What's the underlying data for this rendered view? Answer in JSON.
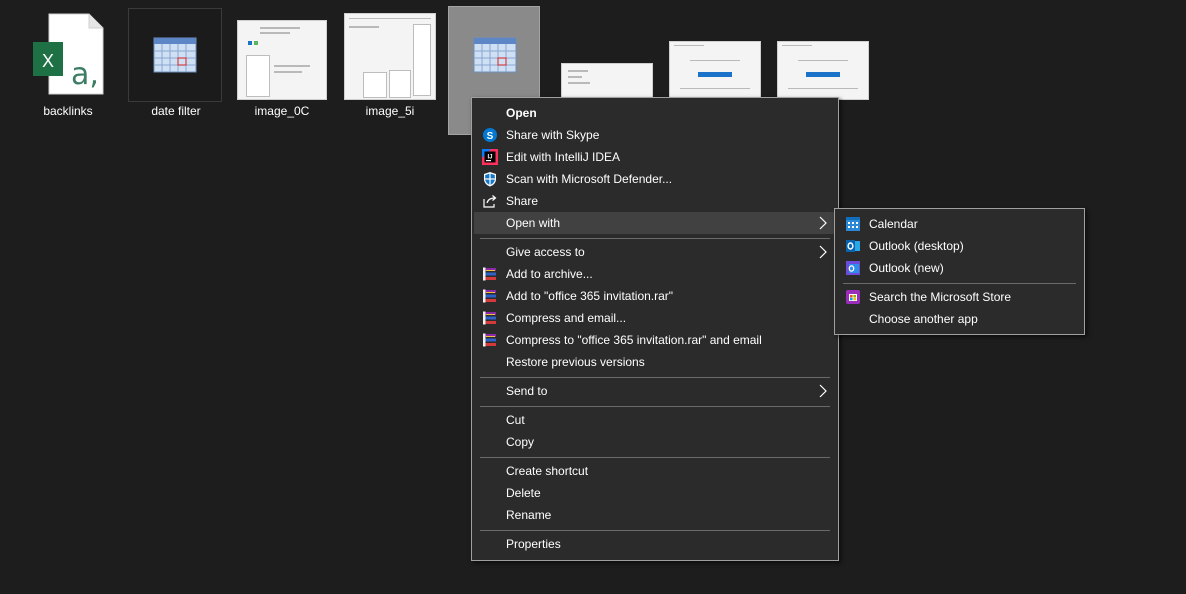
{
  "desktop": {
    "files": [
      {
        "name": "backlinks",
        "icon": "excel-file-icon"
      },
      {
        "name": "date filter",
        "icon": "calendar-file-icon"
      },
      {
        "name": "image_0C",
        "icon": "image-thumbnail"
      },
      {
        "name": "image_5i",
        "icon": "image-thumbnail"
      },
      {
        "name": "",
        "icon": "calendar-file-icon",
        "selected": true
      },
      {
        "name": "",
        "icon": "image-thumbnail"
      },
      {
        "name": "",
        "icon": "image-thumbnail"
      },
      {
        "name": "",
        "icon": "image-thumbnail"
      }
    ],
    "excel_glyph": "X",
    "excel_letter": "a,"
  },
  "context_menu": {
    "items": [
      {
        "label": "Open",
        "icon": "none",
        "bold": true
      },
      {
        "label": "Share with Skype",
        "icon": "skype-icon"
      },
      {
        "label": "Edit with IntelliJ IDEA",
        "icon": "intellij-icon"
      },
      {
        "label": "Scan with Microsoft Defender...",
        "icon": "defender-shield-icon"
      },
      {
        "label": "Share",
        "icon": "share-icon"
      },
      {
        "label": "Open with",
        "icon": "none",
        "submenu": true,
        "highlighted": true
      },
      {
        "label": "Give access to",
        "icon": "none",
        "submenu": true
      },
      {
        "label": "Add to archive...",
        "icon": "winrar-icon"
      },
      {
        "label": "Add to \"office 365 invitation.rar\"",
        "icon": "winrar-icon"
      },
      {
        "label": "Compress and email...",
        "icon": "winrar-icon"
      },
      {
        "label": "Compress to \"office 365 invitation.rar\" and email",
        "icon": "winrar-icon"
      },
      {
        "label": "Restore previous versions",
        "icon": "none"
      },
      {
        "label": "Send to",
        "icon": "none",
        "submenu": true
      },
      {
        "label": "Cut",
        "icon": "none"
      },
      {
        "label": "Copy",
        "icon": "none"
      },
      {
        "label": "Create shortcut",
        "icon": "none"
      },
      {
        "label": "Delete",
        "icon": "none"
      },
      {
        "label": "Rename",
        "icon": "none"
      },
      {
        "label": "Properties",
        "icon": "none"
      }
    ]
  },
  "open_with_submenu": {
    "items": [
      {
        "label": "Calendar",
        "icon": "calendar-app-icon"
      },
      {
        "label": "Outlook (desktop)",
        "icon": "outlook-icon"
      },
      {
        "label": "Outlook (new)",
        "icon": "outlook-new-icon"
      },
      {
        "label": "Search the Microsoft Store",
        "icon": "microsoft-store-icon"
      },
      {
        "label": "Choose another app",
        "icon": "none"
      }
    ]
  },
  "colors": {
    "background": "#1d1d1d",
    "menu_bg": "#2b2b2b",
    "menu_highlight": "#414141",
    "excel_green": "#1e7145",
    "skype_blue": "#0078d4"
  }
}
